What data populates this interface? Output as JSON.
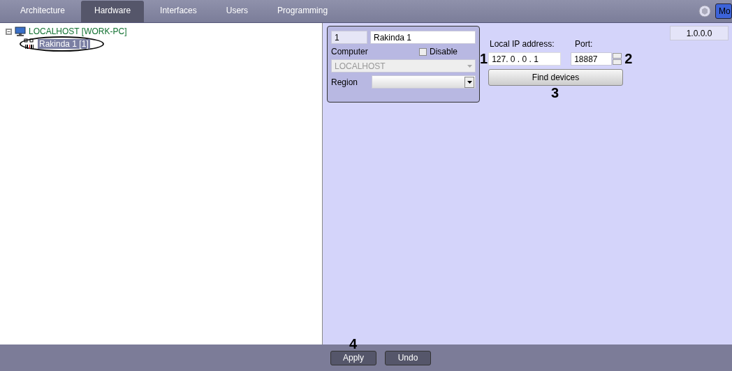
{
  "tabs": [
    {
      "label": "Architecture",
      "selected": false
    },
    {
      "label": "Hardware",
      "selected": true
    },
    {
      "label": "Interfaces",
      "selected": false
    },
    {
      "label": "Users",
      "selected": false
    },
    {
      "label": "Programming",
      "selected": false
    }
  ],
  "mode_button": "Mo",
  "tree": [
    {
      "label": "LOCALHOST [WORK-PC]",
      "kind": "computer",
      "expanded": true,
      "selected": false,
      "children": [
        {
          "label": "Rakinda 1 [1]",
          "kind": "reader",
          "selected": true,
          "circled": true
        }
      ]
    }
  ],
  "form": {
    "id": "1",
    "name": "Rakinda 1",
    "computer_label": "Computer",
    "disable": {
      "label": "Disable",
      "checked": false
    },
    "computer": {
      "value": "LOCALHOST",
      "disabled": true
    },
    "region_label": "Region"
  },
  "network": {
    "ip_label": "Local IP address:",
    "ip": "127. 0 . 0 . 1",
    "port_label": "Port:",
    "port": "18887",
    "find_button": "Find devices"
  },
  "version": "1.0.0.0",
  "callouts": [
    "1",
    "2",
    "3",
    "4"
  ],
  "buttons": [
    {
      "label": "Apply"
    },
    {
      "label": "Undo"
    }
  ]
}
